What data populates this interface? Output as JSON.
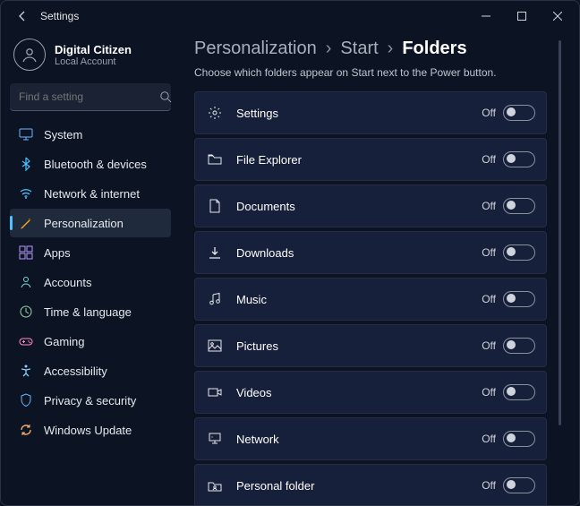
{
  "titlebar": {
    "title": "Settings"
  },
  "user": {
    "name": "Digital Citizen",
    "account": "Local Account"
  },
  "search": {
    "placeholder": "Find a setting"
  },
  "sidebar": {
    "items": [
      {
        "label": "System",
        "icon": "system",
        "selected": false
      },
      {
        "label": "Bluetooth & devices",
        "icon": "bluetooth",
        "selected": false
      },
      {
        "label": "Network & internet",
        "icon": "wifi",
        "selected": false
      },
      {
        "label": "Personalization",
        "icon": "personalization",
        "selected": true
      },
      {
        "label": "Apps",
        "icon": "apps",
        "selected": false
      },
      {
        "label": "Accounts",
        "icon": "accounts",
        "selected": false
      },
      {
        "label": "Time & language",
        "icon": "time",
        "selected": false
      },
      {
        "label": "Gaming",
        "icon": "gaming",
        "selected": false
      },
      {
        "label": "Accessibility",
        "icon": "accessibility",
        "selected": false
      },
      {
        "label": "Privacy & security",
        "icon": "privacy",
        "selected": false
      },
      {
        "label": "Windows Update",
        "icon": "update",
        "selected": false
      }
    ]
  },
  "breadcrumbs": [
    "Personalization",
    "Start",
    "Folders"
  ],
  "description": "Choose which folders appear on Start next to the Power button.",
  "toggle_off_label": "Off",
  "folders": [
    {
      "label": "Settings",
      "icon": "settings",
      "state": "Off"
    },
    {
      "label": "File Explorer",
      "icon": "explorer",
      "state": "Off"
    },
    {
      "label": "Documents",
      "icon": "document",
      "state": "Off"
    },
    {
      "label": "Downloads",
      "icon": "downloads",
      "state": "Off"
    },
    {
      "label": "Music",
      "icon": "music",
      "state": "Off"
    },
    {
      "label": "Pictures",
      "icon": "pictures",
      "state": "Off"
    },
    {
      "label": "Videos",
      "icon": "videos",
      "state": "Off"
    },
    {
      "label": "Network",
      "icon": "network",
      "state": "Off"
    },
    {
      "label": "Personal folder",
      "icon": "personal",
      "state": "Off"
    }
  ]
}
